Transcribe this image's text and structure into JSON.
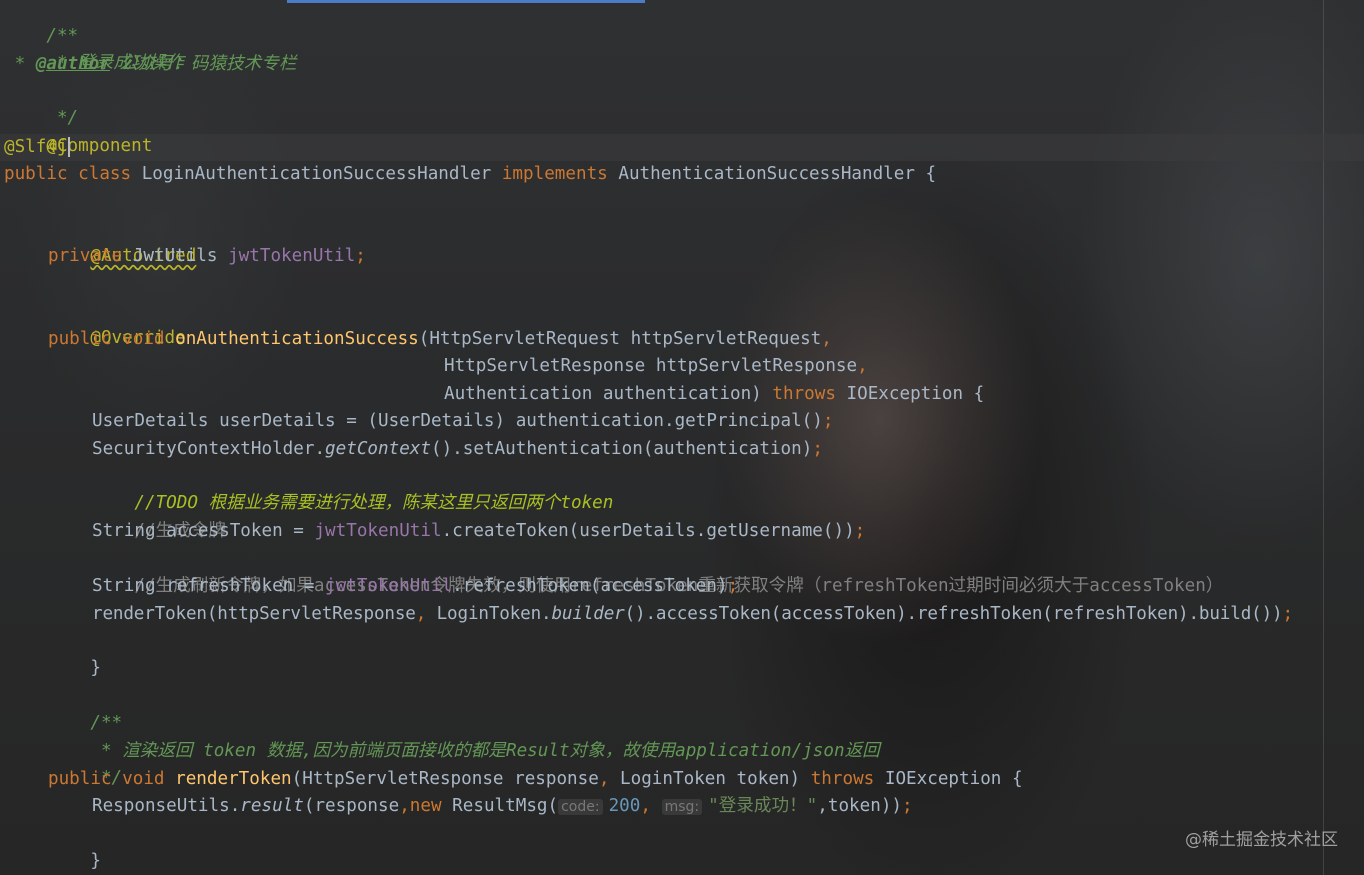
{
  "editor": {
    "colors": {
      "keyword": "#cc7832",
      "function": "#ffc66d",
      "field": "#9876aa",
      "comment": "#629755",
      "annotation": "#bbb529",
      "number": "#6897bb",
      "string": "#6a8759",
      "text": "#a9b7c6"
    },
    "lines": {
      "l1": "/**",
      "l2": " * 登录成功操作",
      "l3a": " * ",
      "l3_tag": "@author",
      "l3b": " 公众号：码猿技术专栏",
      "l4": " */",
      "l5": "@Component",
      "l6": "@Slf4j",
      "l7a": "public class",
      "l7b": " LoginAuthenticationSuccessHandler ",
      "l7c": "implements",
      "l7d": " AuthenticationSuccessHandler {",
      "l9": "@Autowired",
      "l10a": "private",
      "l10b": " JwtUtils ",
      "l10c": "jwtTokenUtil",
      "l10d": ";",
      "l12": "@Override",
      "l13a": "public void",
      "l13b": " ",
      "l13c": "onAuthenticationSuccess",
      "l13d": "(HttpServletRequest httpServletRequest",
      "l13e": ",",
      "l14a": "HttpServletResponse httpServletResponse",
      "l14b": ",",
      "l15a": "Authentication authentication) ",
      "l15b": "throws",
      "l15c": " IOException {",
      "l16a": "UserDetails userDetails = (UserDetails) authentication.getPrincipal()",
      "l16b": ";",
      "l17a": "SecurityContextHolder.",
      "l17b": "getContext",
      "l17c": "().setAuthentication(authentication)",
      "l17d": ";",
      "l18": "//TODO 根据业务需要进行处理，陈某这里只返回两个token",
      "l19": "//生成令牌",
      "l20a": "String accessToken = ",
      "l20b": "jwtTokenUtil",
      "l20c": ".createToken(userDetails.getUsername())",
      "l20d": ";",
      "l21": "//生成刷新令牌，如果accessToken令牌失效，则使用refreshToken重新获取令牌（refreshToken过期时间必须大于accessToken）",
      "l22a": "String refreshToken = ",
      "l22b": "jwtTokenUtil",
      "l22c": ".refreshToken(accessToken)",
      "l22d": ";",
      "l23a": "renderToken(httpServletResponse",
      "l23b": ",",
      "l23c": " LoginToken.",
      "l23d": "builder",
      "l23e": "().accessToken(accessToken).refreshToken(refreshToken).build())",
      "l23f": ";",
      "l24": "}",
      "l26": "/**",
      "l27": " * 渲染返回 token 数据,因为前端页面接收的都是Result对象，故使用application/json返回",
      "l28": " */",
      "l29a": "public void",
      "l29b": " ",
      "l29c": "renderToken",
      "l29d": "(HttpServletResponse response",
      "l29e": ",",
      "l29f": " LoginToken token) ",
      "l29g": "throws",
      "l29h": " IOException {",
      "l30a": "ResponseUtils.",
      "l30b": "result",
      "l30c": "(response",
      "l30d": ",",
      "l30e": "new",
      "l30f": " ResultMsg(",
      "l30_hint_code": "code:",
      "l30_num": "200",
      "l30g": ", ",
      "l30_hint_msg": "msg:",
      "l30_str": "\"登录成功！\"",
      "l30h": ",token))",
      "l30i": ";",
      "l31": "}",
      "l32": "}"
    }
  },
  "watermark": "@稀土掘金技术社区"
}
